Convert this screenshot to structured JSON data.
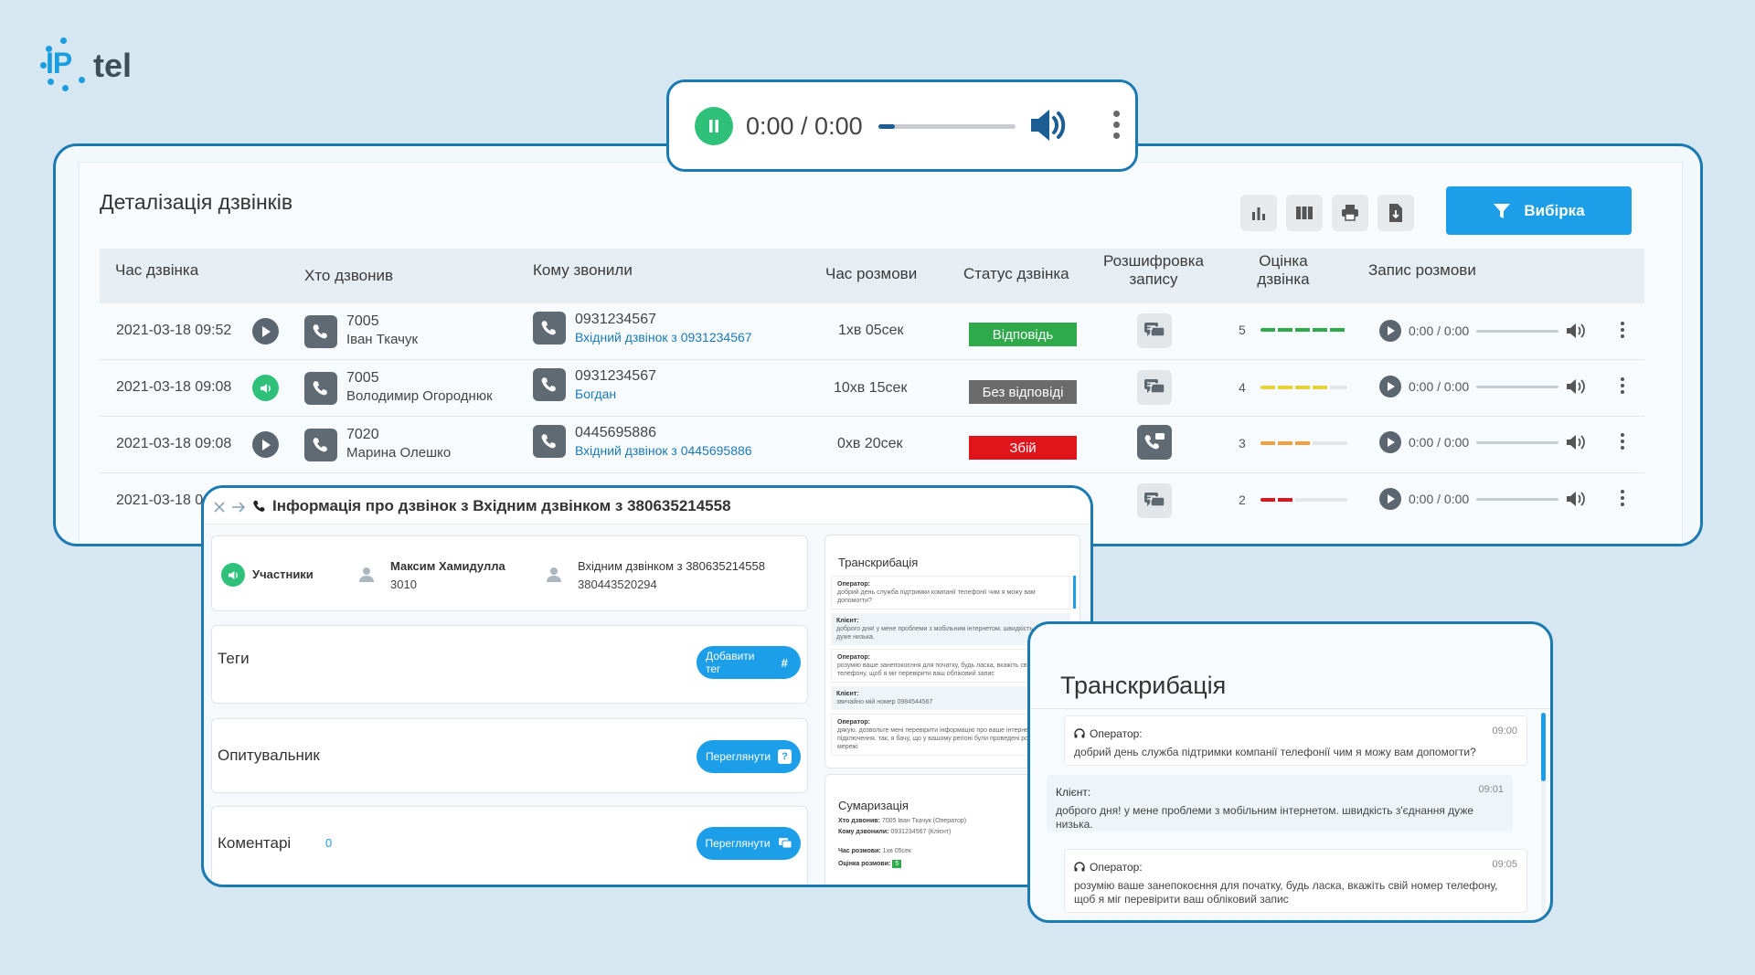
{
  "brand": {
    "logo_ip": "IP",
    "logo_tel": "tel"
  },
  "player": {
    "time": "0:00 / 0:00",
    "progress": 0.12
  },
  "page": {
    "title": "Деталізація дзвінків",
    "filter_label": "Вибірка",
    "tools": [
      "chart-icon",
      "columns-icon",
      "print-icon",
      "export-icon"
    ]
  },
  "table": {
    "headers": {
      "time": "Час дзвінка",
      "caller": "Хто дзвонив",
      "callee": "Кому звонили",
      "duration": "Час розмови",
      "status": "Статус дзвінка",
      "decode": "Розшифровка запису",
      "score": "Оцінка дзвінка",
      "record": "Запис розмови"
    },
    "rows": [
      {
        "time": "2021-03-18 09:52",
        "caller_num": "7005",
        "caller_name": "Іван Ткачук",
        "callee_num": "0931234567",
        "callee_sub": "Вхідний дзвінок з 0931234567",
        "duration": "1хв 05сек",
        "status": "Відповідь",
        "score": "5",
        "record": "0:00 / 0:00"
      },
      {
        "time": "2021-03-18 09:08",
        "caller_num": "7005",
        "caller_name": "Володимир Огороднюк",
        "callee_num": "0931234567",
        "callee_sub": "Богдан",
        "duration": "10хв 15сек",
        "status": "Без відповіді",
        "score": "4",
        "record": "0:00 / 0:00"
      },
      {
        "time": "2021-03-18 09:08",
        "caller_num": "7020",
        "caller_name": "Марина Олешко",
        "callee_num": "0445695886",
        "callee_sub": "Вхідний дзвінок з 0445695886",
        "duration": "0хв 20сек",
        "status": "Збій",
        "score": "3",
        "record": "0:00 / 0:00"
      },
      {
        "time": "2021-03-18 0",
        "score": "2",
        "record": "0:00 / 0:00"
      }
    ],
    "colors": {
      "answered": "#2eaa4a",
      "unanswered": "#6b6b6b",
      "failed": "#e0141b"
    }
  },
  "info": {
    "title": "Інформація про дзвінок з Вхідним дзвінком з 380635214558",
    "participants_label": "Участники",
    "p1_name": "Максим Хамидулла",
    "p1_num": "3010",
    "p2_name": "Вхідним дзвінком з 380635214558",
    "p2_num": "380443520294",
    "tags_label": "Теги",
    "tags_btn": "Добавити тег",
    "survey_label": "Опитувальник",
    "survey_btn": "Переглянути",
    "comments_label": "Коментарі",
    "comments_count": "0",
    "comments_btn": "Переглянути",
    "transcription_label": "Транскрибація",
    "summary_label": "Сумаризація",
    "mini_msgs": [
      {
        "who": "Оператор:",
        "text": "добрий день служба підтримки компанії телефонії чим я можу вам допомогти?"
      },
      {
        "who": "Клієнт:",
        "text": "доброго дня! у мене проблеми з мобільним інтернетом. швидкість з'єднання дуже низька."
      },
      {
        "who": "Оператор:",
        "text": "розумію ваше занепокоєння для початку, будь ласка, вкажіть свій номер телефону, щоб я міг перевірити ваш обліковий запис"
      },
      {
        "who": "Клієнт:",
        "text": "звичайно мій номер 0984544567"
      },
      {
        "who": "Оператор:",
        "text": "дякую. дозвольте мені перевірити інформацію про ваше інтернет-підключення. так, я бачу, що у вашому регіоні були проведені роботи на мережі"
      }
    ],
    "summary_rows": [
      {
        "k": "Хто дзвонив:",
        "v": "7005 Іван Ткачук",
        "note": "(Оператор)"
      },
      {
        "k": "Кому дзвонили:",
        "v": "0931234567",
        "note": "(Клієнт)"
      },
      {
        "k": "Час розмови:",
        "v": "1хв 05сек",
        "note": ""
      },
      {
        "k": "Оцінка розмови:",
        "v": "5",
        "note": ""
      }
    ]
  },
  "transcription": {
    "title": "Транскрибація",
    "messages": [
      {
        "who": "Оператор:",
        "ts": "09:00",
        "text": "добрий день служба підтримки компанії телефонії чим я можу вам допомогти?"
      },
      {
        "who": "Клієнт:",
        "ts": "09:01",
        "text": "доброго дня! у мене проблеми з мобільним інтернетом. швидкість з'єднання дуже низька."
      },
      {
        "who": "Оператор:",
        "ts": "09:05",
        "text": "розумію ваше занепокоєння для початку, будь ласка, вкажіть свій номер телефону, щоб я міг перевірити ваш обліковий запис"
      }
    ]
  }
}
